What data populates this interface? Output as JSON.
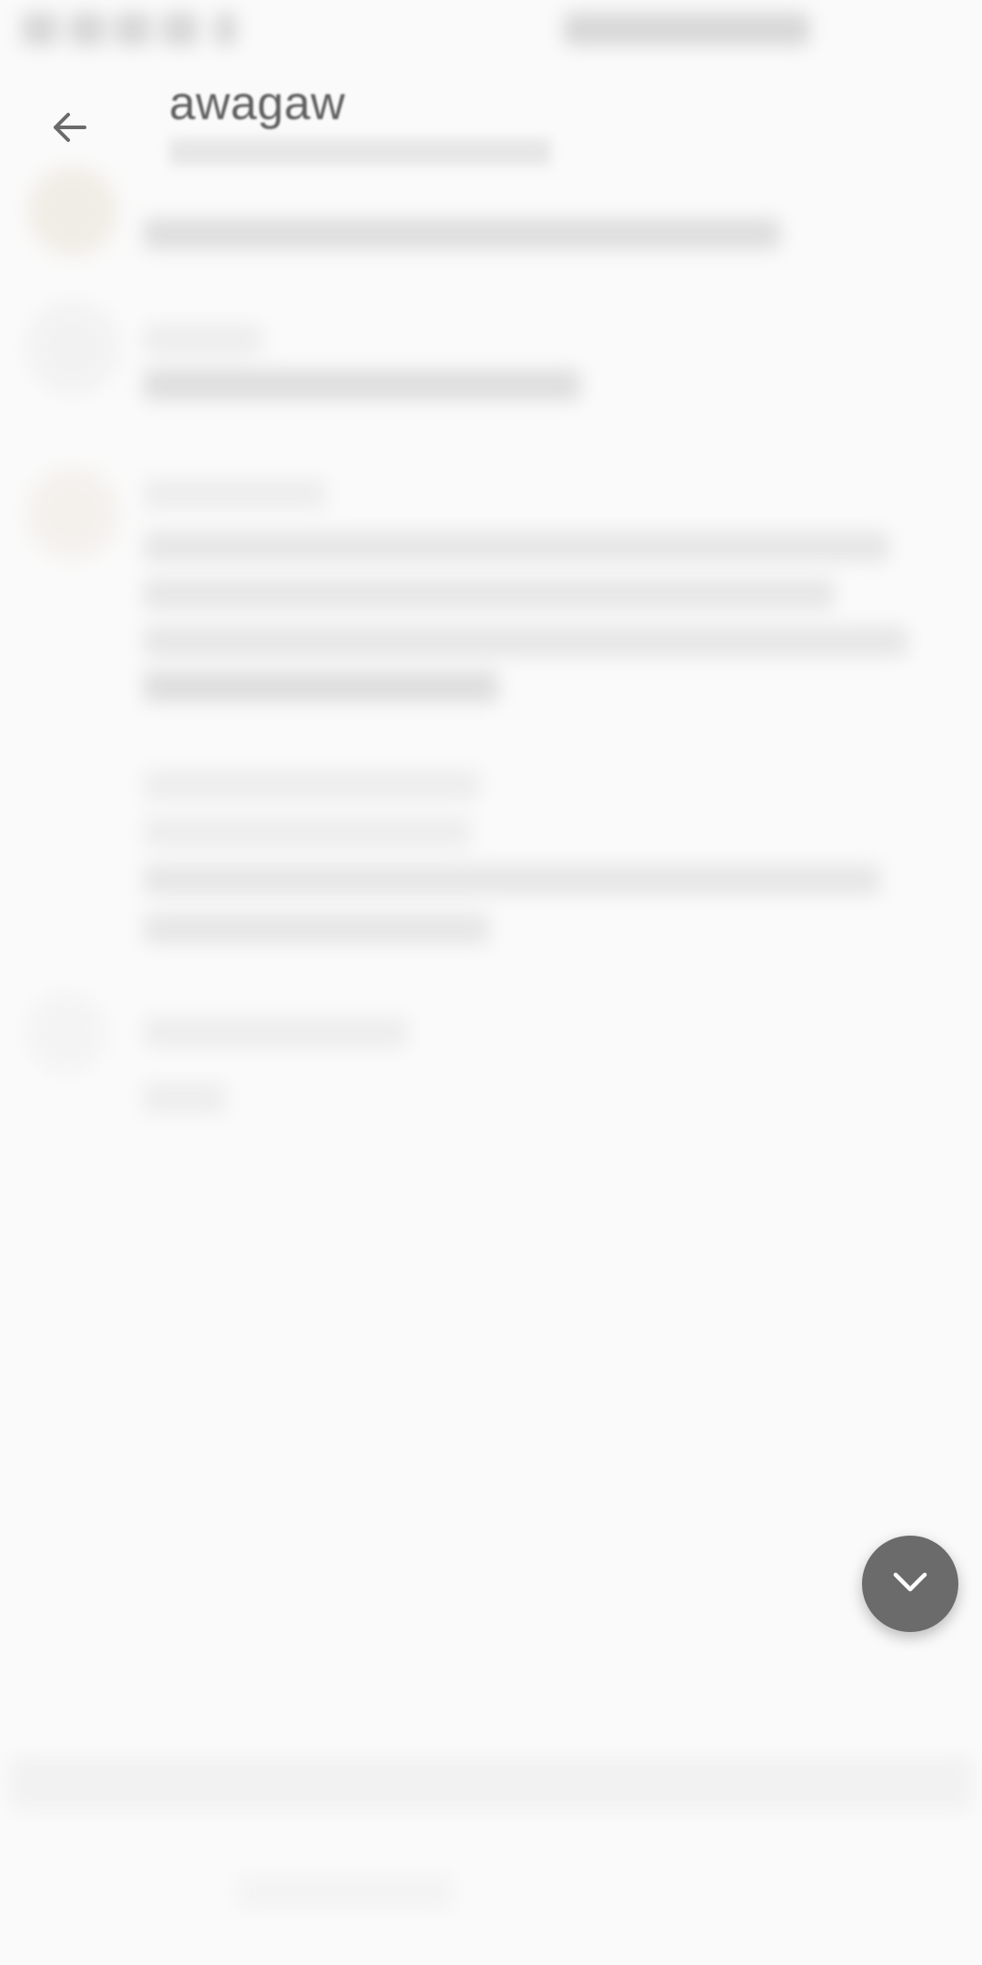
{
  "header": {
    "title": "awagaw"
  },
  "icons": {
    "back": "arrow-left-icon",
    "scroll_down": "chevron-down-icon"
  },
  "colors": {
    "fab_background": "#6b6b6b",
    "page_background": "#fafafa"
  }
}
